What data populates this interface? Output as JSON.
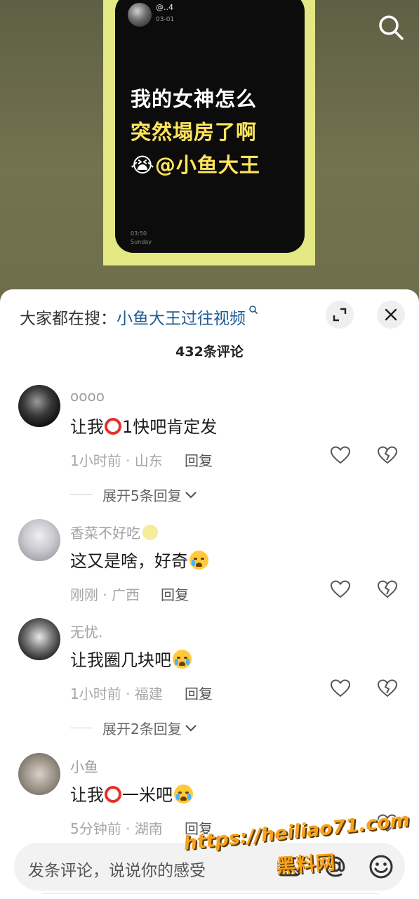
{
  "video": {
    "author_name": "@..4",
    "author_date": "03-01",
    "caption_line1": "我的女神怎么",
    "caption_line2": "突然塌房了啊",
    "caption_line3_emoji": "😭",
    "caption_line3_text": "@小鱼大王",
    "time": "03:50",
    "day": "Sunday"
  },
  "sheet": {
    "suggest_prefix": "大家都在搜：",
    "suggest_link": "小鱼大王过往视频",
    "comment_count": "432条评论"
  },
  "comments": [
    {
      "username": "oooo",
      "text_before": "让我",
      "text_after": "1快吧肯定发",
      "meta": "1小时前 · 山东",
      "reply": "回复",
      "expand": "展开5条回复"
    },
    {
      "username": "香菜不好吃",
      "text": "这又是啥，好奇",
      "meta": "刚刚 · 广西",
      "reply": "回复"
    },
    {
      "username": "无忧.",
      "text": "让我圈几块吧",
      "meta": "1小时前 · 福建",
      "reply": "回复",
      "expand": "展开2条回复"
    },
    {
      "username": "小鱼",
      "text_before": "让我",
      "text_after": "一米吧",
      "meta": "5分钟前 · 湖南",
      "reply": "回复"
    }
  ],
  "input": {
    "placeholder": "发条评论，说说你的感受"
  },
  "watermark": {
    "line1": "https://heiliao71.com",
    "line2": "黑料网"
  },
  "icons": {
    "search": "search-icon",
    "expand": "fullscreen-icon",
    "close": "close-icon",
    "like": "heart-icon",
    "dislike": "broken-heart-icon",
    "image": "image-icon",
    "mention": "at-icon",
    "emoji": "emoji-icon"
  },
  "colors": {
    "link": "#1f5b95",
    "caption_highlight": "#ffe45c",
    "poster_frame": "#e4e882"
  }
}
